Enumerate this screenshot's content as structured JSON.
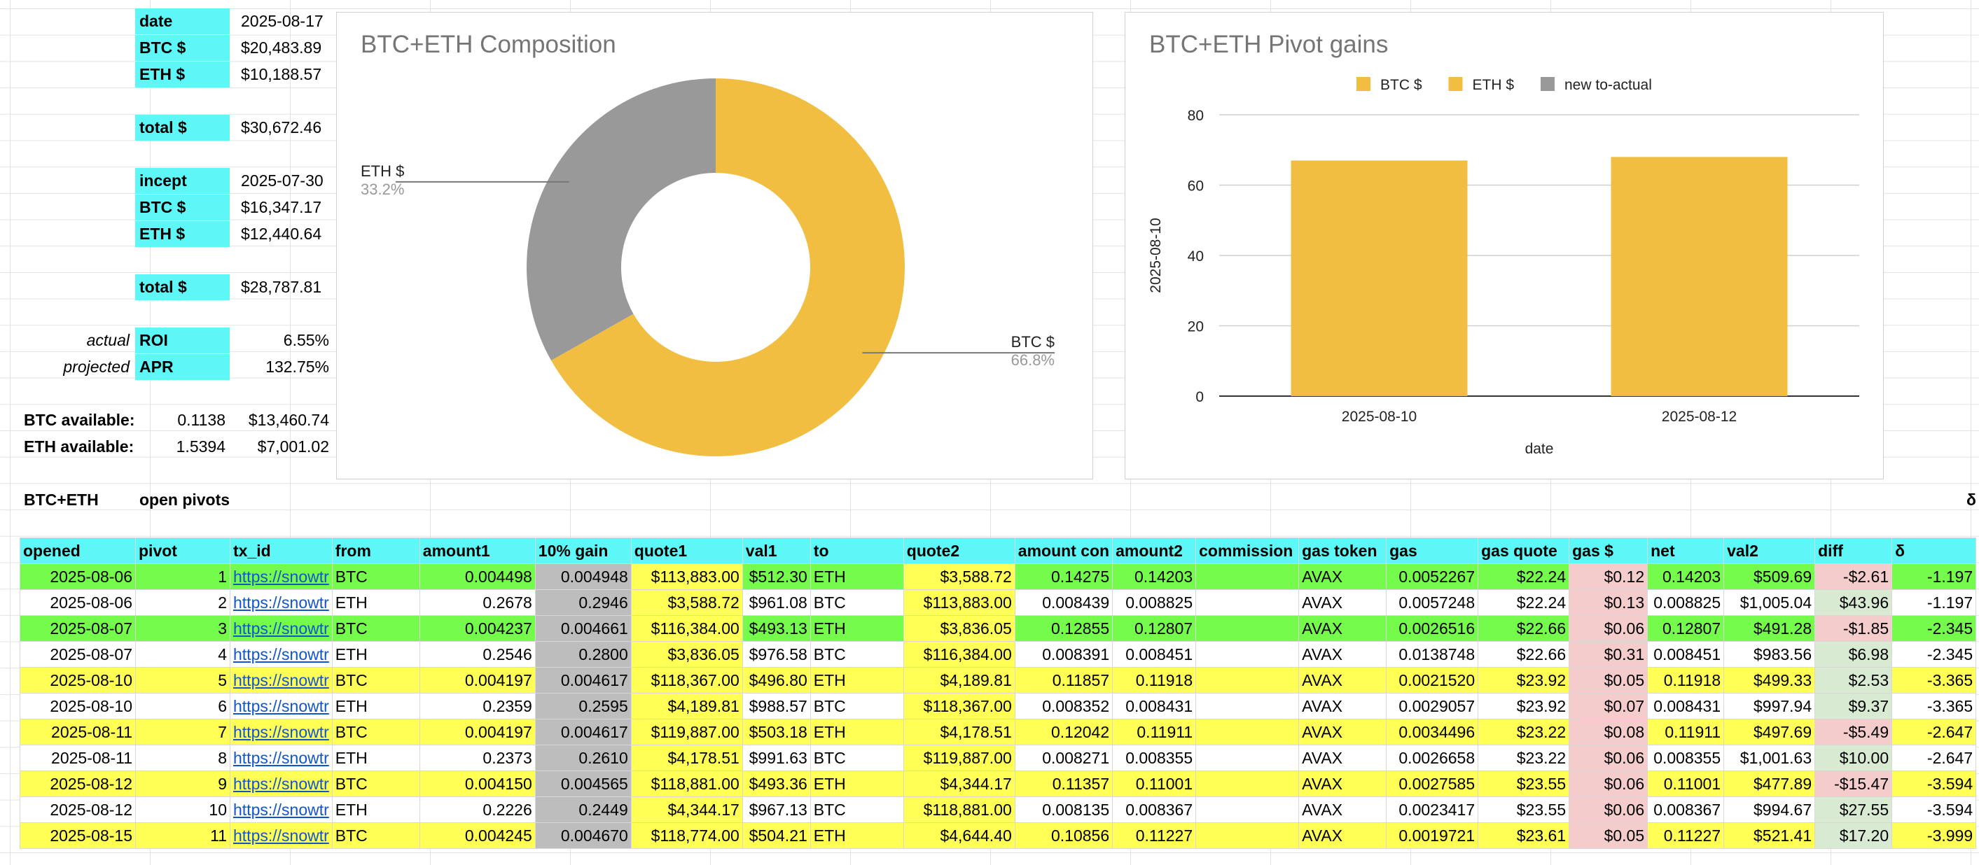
{
  "summary": {
    "date_label": "date",
    "date_value": "2025-08-17",
    "btc_label": "BTC $",
    "btc_value": "$20,483.89",
    "eth_label": "ETH $",
    "eth_value": "$10,188.57",
    "total_label": "total $",
    "total_value": "$30,672.46",
    "incept_label": "incept",
    "incept_value": "2025-07-30",
    "incept_btc_label": "BTC $",
    "incept_btc_value": "$16,347.17",
    "incept_eth_label": "ETH $",
    "incept_eth_value": "$12,440.64",
    "incept_total_label": "total $",
    "incept_total_value": "$28,787.81",
    "actual_label": "actual",
    "roi_label": "ROI",
    "roi_value": "6.55%",
    "projected_label": "projected",
    "apr_label": "APR",
    "apr_value": "132.75%",
    "btc_avail_label": "BTC available:",
    "btc_avail_qty": "0.1138",
    "btc_avail_usd": "$13,460.74",
    "eth_avail_label": "ETH available:",
    "eth_avail_qty": "1.5394",
    "eth_avail_usd": "$7,001.02",
    "section_label": "BTC+ETH",
    "section_title": "open pivots",
    "delta_sym": "δ"
  },
  "chart_data": [
    {
      "type": "pie",
      "title": "BTC+ETH Composition",
      "labels": [
        "BTC $",
        "ETH $"
      ],
      "values": [
        66.8,
        33.2
      ],
      "value_labels": [
        "66.8%",
        "33.2%"
      ],
      "colors": [
        "#f1be42",
        "#999999"
      ],
      "donut": true
    },
    {
      "type": "bar",
      "title": "BTC+ETH Pivot gains",
      "categories": [
        "2025-08-10",
        "2025-08-12"
      ],
      "series": [
        {
          "name": "BTC $",
          "values": [
            67,
            68
          ],
          "color": "#f1be42"
        },
        {
          "name": "ETH $",
          "values": [
            0,
            0
          ],
          "color": "#f1be42"
        },
        {
          "name": "new to-actual",
          "values": [
            0,
            0
          ],
          "color": "#999999"
        }
      ],
      "xlabel": "date",
      "ylabel": "2025-08-10",
      "ylim": [
        0,
        80
      ],
      "yticks": [
        "0",
        "20",
        "40",
        "60",
        "80"
      ],
      "legend": "top",
      "grid": true
    }
  ],
  "table": {
    "headers": [
      "opened",
      "pivot",
      "tx_id",
      "from",
      "amount1",
      "10% gain",
      "quote1",
      "val1",
      "to",
      "quote2",
      "amount con",
      "amount2",
      "commission",
      "gas token",
      "gas",
      "gas quote",
      "gas $",
      "net",
      "val2",
      "diff",
      "δ"
    ],
    "rows": [
      {
        "style": "g",
        "cells": [
          "2025-08-06",
          "1",
          "https://snowtr",
          "BTC",
          "0.004498",
          "0.004948",
          "$113,883.00",
          "$512.30",
          "ETH",
          "$3,588.72",
          "0.14275",
          "0.14203",
          "",
          "AVAX",
          "0.0052267",
          "$22.24",
          "$0.12",
          "0.14203",
          "$509.69",
          "-$2.61",
          "-1.197"
        ]
      },
      {
        "style": "w",
        "cells": [
          "2025-08-06",
          "2",
          "https://snowtr",
          "ETH",
          "0.2678",
          "0.2946",
          "$3,588.72",
          "$961.08",
          "BTC",
          "$113,883.00",
          "0.008439",
          "0.008825",
          "",
          "AVAX",
          "0.0057248",
          "$22.24",
          "$0.13",
          "0.008825",
          "$1,005.04",
          "$43.96",
          "-1.197"
        ]
      },
      {
        "style": "g",
        "cells": [
          "2025-08-07",
          "3",
          "https://snowtr",
          "BTC",
          "0.004237",
          "0.004661",
          "$116,384.00",
          "$493.13",
          "ETH",
          "$3,836.05",
          "0.12855",
          "0.12807",
          "",
          "AVAX",
          "0.0026516",
          "$22.66",
          "$0.06",
          "0.12807",
          "$491.28",
          "-$1.85",
          "-2.345"
        ]
      },
      {
        "style": "w",
        "cells": [
          "2025-08-07",
          "4",
          "https://snowtr",
          "ETH",
          "0.2546",
          "0.2800",
          "$3,836.05",
          "$976.58",
          "BTC",
          "$116,384.00",
          "0.008391",
          "0.008451",
          "",
          "AVAX",
          "0.0138748",
          "$22.66",
          "$0.31",
          "0.008451",
          "$983.56",
          "$6.98",
          "-2.345"
        ]
      },
      {
        "style": "y",
        "cells": [
          "2025-08-10",
          "5",
          "https://snowtr",
          "BTC",
          "0.004197",
          "0.004617",
          "$118,367.00",
          "$496.80",
          "ETH",
          "$4,189.81",
          "0.11857",
          "0.11918",
          "",
          "AVAX",
          "0.0021520",
          "$23.92",
          "$0.05",
          "0.11918",
          "$499.33",
          "$2.53",
          "-3.365"
        ]
      },
      {
        "style": "w",
        "cells": [
          "2025-08-10",
          "6",
          "https://snowtr",
          "ETH",
          "0.2359",
          "0.2595",
          "$4,189.81",
          "$988.57",
          "BTC",
          "$118,367.00",
          "0.008352",
          "0.008431",
          "",
          "AVAX",
          "0.0029057",
          "$23.92",
          "$0.07",
          "0.008431",
          "$997.94",
          "$9.37",
          "-3.365"
        ]
      },
      {
        "style": "y",
        "cells": [
          "2025-08-11",
          "7",
          "https://snowtr",
          "BTC",
          "0.004197",
          "0.004617",
          "$119,887.00",
          "$503.18",
          "ETH",
          "$4,178.51",
          "0.12042",
          "0.11911",
          "",
          "AVAX",
          "0.0034496",
          "$23.22",
          "$0.08",
          "0.11911",
          "$497.69",
          "-$5.49",
          "-2.647"
        ]
      },
      {
        "style": "w",
        "cells": [
          "2025-08-11",
          "8",
          "https://snowtr",
          "ETH",
          "0.2373",
          "0.2610",
          "$4,178.51",
          "$991.63",
          "BTC",
          "$119,887.00",
          "0.008271",
          "0.008355",
          "",
          "AVAX",
          "0.0026658",
          "$23.22",
          "$0.06",
          "0.008355",
          "$1,001.63",
          "$10.00",
          "-2.647"
        ]
      },
      {
        "style": "y",
        "cells": [
          "2025-08-12",
          "9",
          "https://snowtr",
          "BTC",
          "0.004150",
          "0.004565",
          "$118,881.00",
          "$493.36",
          "ETH",
          "$4,344.17",
          "0.11357",
          "0.11001",
          "",
          "AVAX",
          "0.0027585",
          "$23.55",
          "$0.06",
          "0.11001",
          "$477.89",
          "-$15.47",
          "-3.594"
        ]
      },
      {
        "style": "w",
        "cells": [
          "2025-08-12",
          "10",
          "https://snowtr",
          "ETH",
          "0.2226",
          "0.2449",
          "$4,344.17",
          "$967.13",
          "BTC",
          "$118,881.00",
          "0.008135",
          "0.008367",
          "",
          "AVAX",
          "0.0023417",
          "$23.55",
          "$0.06",
          "0.008367",
          "$994.67",
          "$27.55",
          "-3.594"
        ]
      },
      {
        "style": "y",
        "cells": [
          "2025-08-15",
          "11",
          "https://snowtr",
          "BTC",
          "0.004245",
          "0.004670",
          "$118,774.00",
          "$504.21",
          "ETH",
          "$4,644.40",
          "0.10856",
          "0.11227",
          "",
          "AVAX",
          "0.0019721",
          "$23.61",
          "$0.05",
          "0.11227",
          "$521.41",
          "$17.20",
          "-3.999"
        ]
      }
    ]
  }
}
